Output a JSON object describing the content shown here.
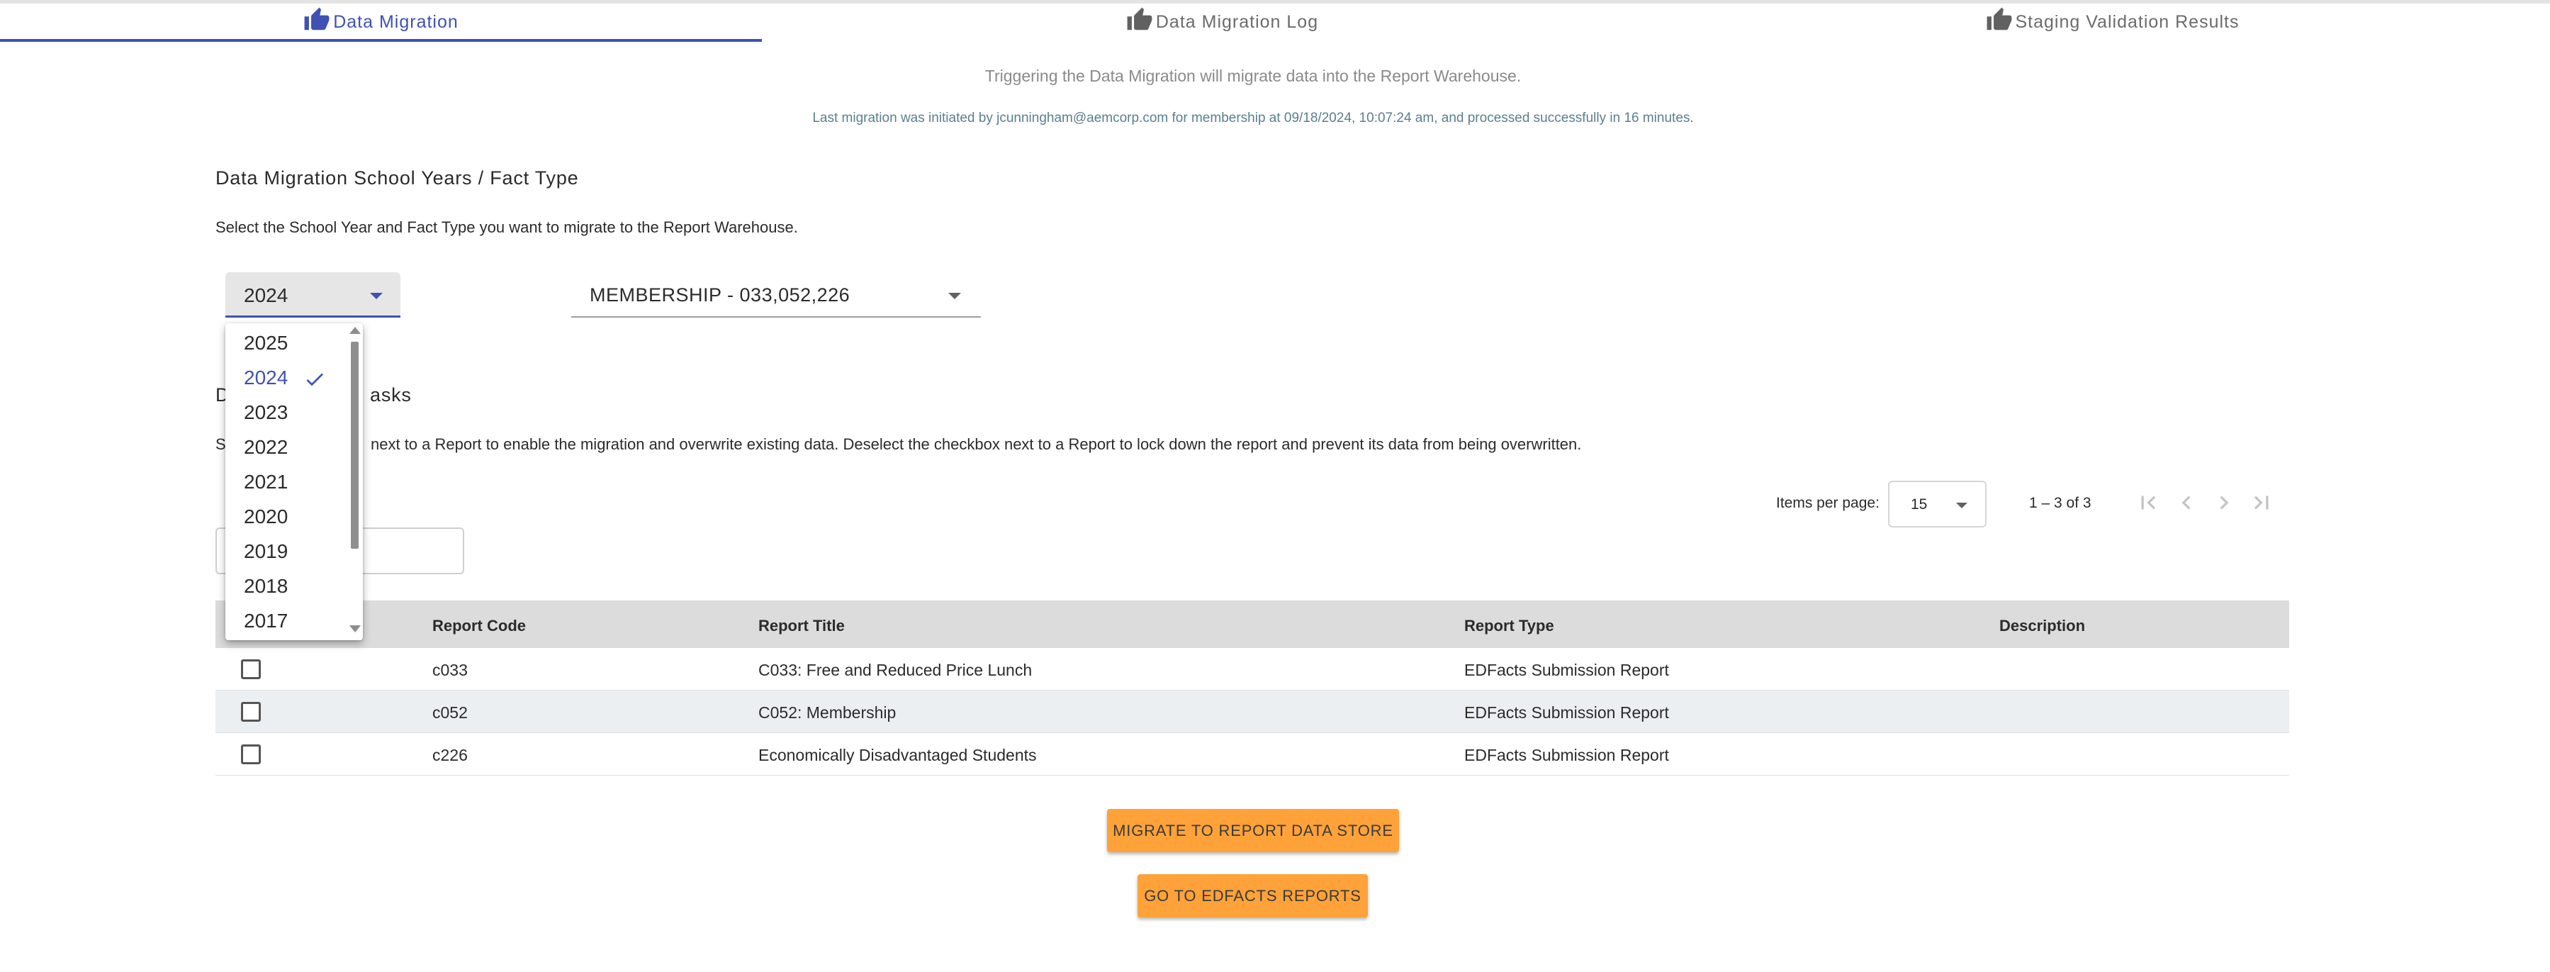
{
  "tabs": [
    {
      "label": "Data Migration",
      "icon": "thumb-up-icon",
      "active": true
    },
    {
      "label": "Data Migration Log",
      "icon": "thumb-up-icon",
      "active": false
    },
    {
      "label": "Staging Validation Results",
      "icon": "thumb-up-icon",
      "active": false
    }
  ],
  "info": {
    "trigger_text": "Triggering the Data Migration will migrate data into the Report Warehouse.",
    "last_migration_text": "Last migration was initiated by jcunningham@aemcorp.com for membership at 09/18/2024, 10:07:24 am, and processed successfully in 16 minutes."
  },
  "school_years": {
    "title": "Data Migration School Years / Fact Type",
    "description": "Select the School Year and Fact Type you want to migrate to the Report Warehouse.",
    "year_value": "2024",
    "fact_value": "MEMBERSHIP - 033,052,226",
    "year_options": [
      "2025",
      "2024",
      "2023",
      "2022",
      "2021",
      "2020",
      "2019",
      "2018",
      "2017"
    ],
    "selected_year": "2024"
  },
  "tasks": {
    "title_fragment_left": "D",
    "title_fragment_right": "asks",
    "desc_fragment_left": "S",
    "desc_fragment_right": "next to a Report to enable the migration and overwrite existing data. Deselect the checkbox next to a Report to lock down the report and prevent its data from being overwritten."
  },
  "paginator": {
    "items_per_page_label": "Items per page:",
    "items_per_page_value": "15",
    "range_label": "1 – 3 of 3"
  },
  "table": {
    "headers": {
      "report_code": "Report Code",
      "report_title": "Report Title",
      "report_type": "Report Type",
      "description": "Description"
    },
    "rows": [
      {
        "code": "c033",
        "title": "C033: Free and Reduced Price Lunch",
        "type": "EDFacts Submission Report",
        "description": "",
        "checked": false
      },
      {
        "code": "c052",
        "title": "C052: Membership",
        "type": "EDFacts Submission Report",
        "description": "",
        "checked": false
      },
      {
        "code": "c226",
        "title": "Economically Disadvantaged Students",
        "type": "EDFacts Submission Report",
        "description": "",
        "checked": false
      }
    ]
  },
  "buttons": {
    "migrate": "MIGRATE TO REPORT DATA STORE",
    "edfacts": "GO TO EDFACTS REPORTS"
  },
  "colors": {
    "primary": "#3f51b5",
    "accent_button": "#ffa23a",
    "header_row": "#dcdcdc",
    "alt_row": "#eceff1"
  }
}
